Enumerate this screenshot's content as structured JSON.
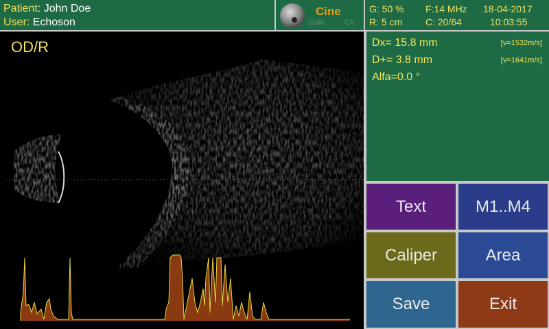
{
  "header": {
    "patient_label": "Patient:",
    "patient_name": "John Doe",
    "user_label": "User:",
    "user_name": "Echoson"
  },
  "cine": {
    "title": "Cine",
    "gain_label": "Gain",
    "cv_label": "CV",
    "knob_icon": "dial-knob-icon"
  },
  "params": {
    "gain": "G:  50 %",
    "frequency": "F:14 MHz",
    "date": "18-04-2017",
    "range": "R:  5 cm",
    "cine_frames": "C: 20/64",
    "time": "10:03:55"
  },
  "measurements": {
    "dx": "Dx= 15.8 mm",
    "dx_velocity": "[v=1532m/s]",
    "dplus": "D+= 3.8 mm",
    "dplus_velocity": "[v=1641m/s]",
    "alfa": "Alfa=0.0 °"
  },
  "image": {
    "view_label": "OD/R"
  },
  "buttons": {
    "text": "Text",
    "m_range": "M1..M4",
    "caliper": "Caliper",
    "area": "Area",
    "save": "Save",
    "exit": "Exit"
  },
  "colors": {
    "panel_green": "#1e6a45",
    "label_yellow": "#f0e060",
    "cine_orange": "#e89a1c",
    "btn_text": "#5a1f7a",
    "btn_m": "#2b3d8a",
    "btn_caliper": "#6b6a1a",
    "btn_area": "#2a4a96",
    "btn_save": "#2f6690",
    "btn_exit": "#8e3a17",
    "a_scan_fill": "#8a3a10",
    "a_scan_line": "#e8d840"
  }
}
